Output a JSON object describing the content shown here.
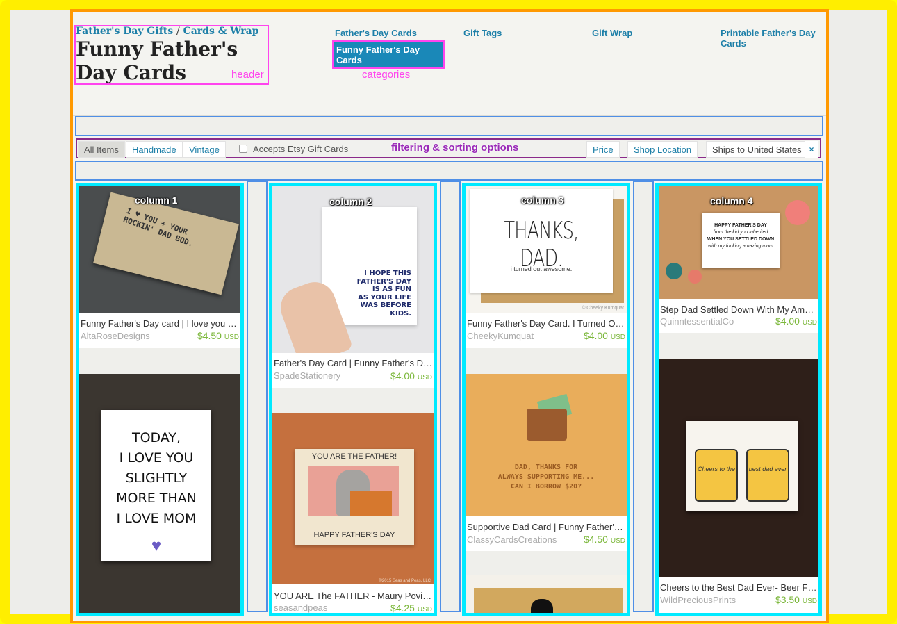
{
  "breadcrumb": {
    "first": "Father's Day Gifts",
    "sep": "/",
    "second": "Cards & Wrap"
  },
  "page_title": "Funny Father's Day Cards",
  "categories": {
    "items": [
      "Father's Day Cards",
      "Gift Tags",
      "Gift Wrap",
      "Printable Father's Day Cards"
    ],
    "active": "Funny Father's Day Cards"
  },
  "annotations": {
    "header": "header",
    "categories": "categories",
    "filter": "filtering & sorting options",
    "col1": "column 1",
    "col2": "column 2",
    "col3": "column 3",
    "col4": "column 4"
  },
  "filters": {
    "all": "All Items",
    "handmade": "Handmade",
    "vintage": "Vintage",
    "gift_cards": "Accepts Etsy Gift Cards",
    "price": "Price",
    "shop_location": "Shop Location",
    "ships_to": "Ships to United States",
    "close": "×"
  },
  "cards": {
    "c1a": {
      "title": "Funny Father's Day card | I love you + your rockin' dad bod",
      "shop": "AltaRoseDesigns",
      "price": "$4.50",
      "cur": "USD",
      "img_text": "I ♥ YOU + YOUR ROCKIN' DAD BOD."
    },
    "c1b": {
      "img_text": [
        "TODAY,",
        "I LOVE YOU",
        "SLIGHTLY",
        "MORE THAN",
        "I LOVE MOM"
      ]
    },
    "c2a": {
      "title": "Father's Day Card | Funny Father's Day Card",
      "shop": "SpadeStationery",
      "price": "$4.00",
      "cur": "USD",
      "img_text": [
        "I HOPE THIS",
        "FATHER'S DAY",
        "IS AS FUN",
        "AS YOUR LIFE",
        "WAS BEFORE",
        "KIDS."
      ]
    },
    "c2b": {
      "title": "YOU ARE The FATHER - Maury Povich Card",
      "shop": "seasandpeas",
      "price": "$4.25",
      "cur": "USD",
      "img_top": "YOU ARE THE FATHER!",
      "img_bottom": "HAPPY FATHER'S DAY",
      "img_copy": "©2015 Seas and Peas, LLC"
    },
    "c3a": {
      "title": "Funny Father's Day Card. I Turned Out Awesome",
      "shop": "CheekyKumquat",
      "price": "$4.00",
      "cur": "USD",
      "img_big": "THANKS, DAD.",
      "img_small": "i turned out awesome.",
      "img_copy": "© Cheeky Kumquat"
    },
    "c3b": {
      "title": "Supportive Dad Card | Funny Father's Day Card",
      "shop": "ClassyCardsCreations",
      "price": "$4.50",
      "cur": "USD",
      "img_text": [
        "DAD, THANKS FOR",
        "ALWAYS SUPPORTING ME...",
        "CAN I BORROW $20?"
      ]
    },
    "c4a": {
      "title": "Step Dad Settled Down With My Amazing Mom Card",
      "shop": "QuinntessentialCo",
      "price": "$4.00",
      "cur": "USD",
      "img_text": [
        "HAPPY FATHER'S DAY",
        "from the kid you inherited",
        "WHEN YOU SETTLED DOWN",
        "with my fucking amazing mom"
      ]
    },
    "c4b": {
      "title": "Cheers to the Best Dad Ever- Beer Father's Day Card",
      "shop": "WildPreciousPrints",
      "price": "$3.50",
      "cur": "USD",
      "img_left": "Cheers to the",
      "img_right": "best dad ever"
    }
  },
  "colors": {
    "link": "#1d7fa8",
    "price": "#7bb73a",
    "annot_pink": "#ff44ee",
    "annot_cyan": "#00eaff",
    "annot_blue": "#4f8fe6",
    "annot_purple": "#8a2a8a",
    "annot_orange": "#ff9900",
    "annot_yellow": "#ffee00"
  }
}
